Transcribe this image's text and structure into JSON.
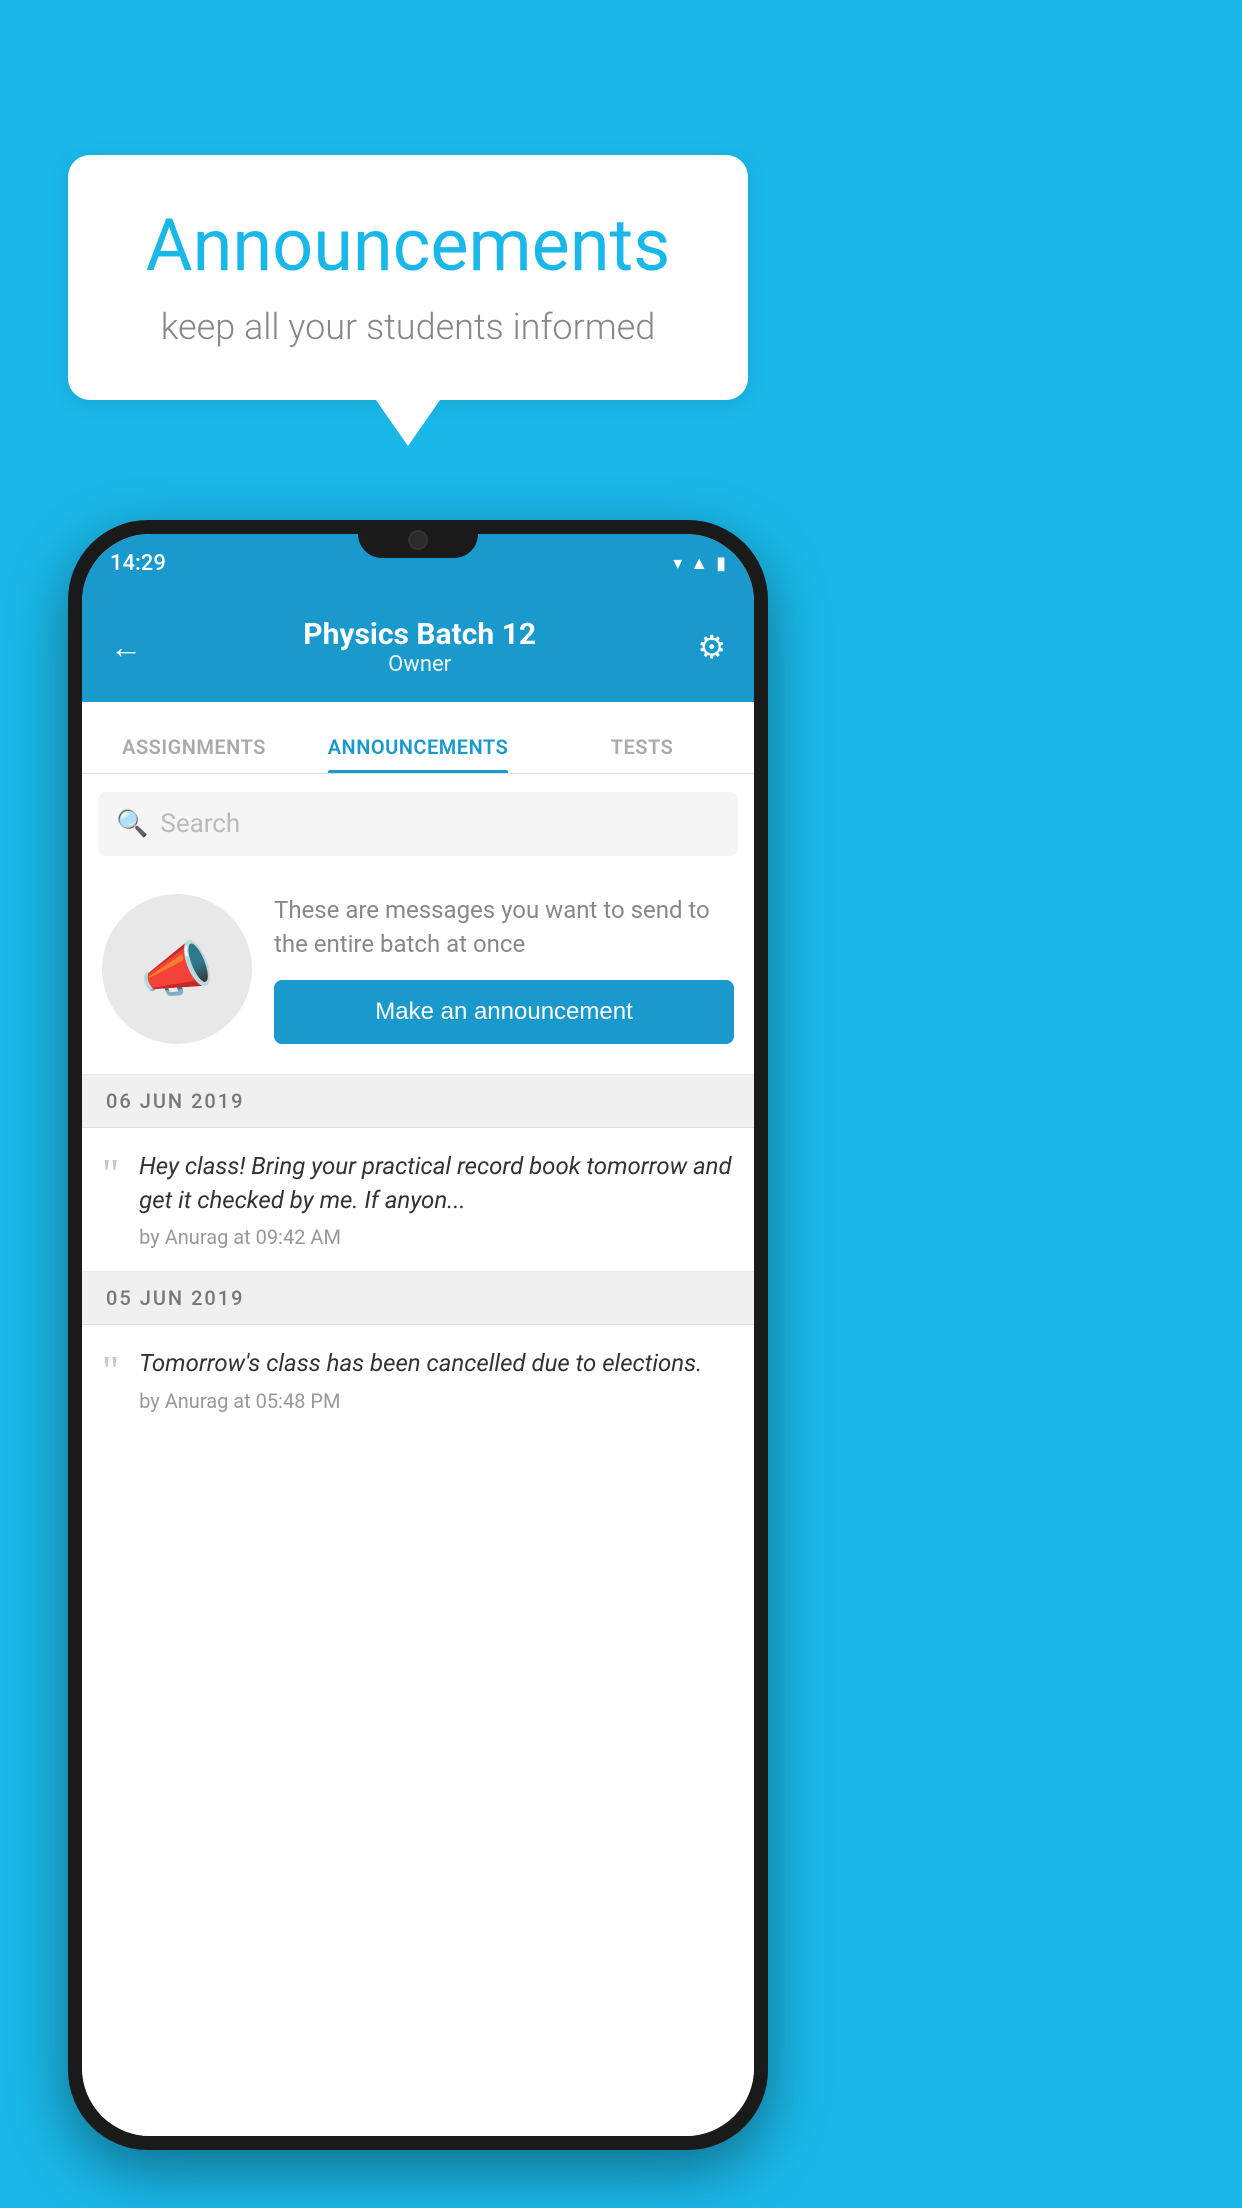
{
  "background_color": "#1ab8e8",
  "speech_bubble": {
    "title": "Announcements",
    "subtitle": "keep all your students informed"
  },
  "status_bar": {
    "time": "14:29",
    "icons": [
      "wifi",
      "signal",
      "battery"
    ]
  },
  "header": {
    "title": "Physics Batch 12",
    "subtitle": "Owner",
    "back_label": "←",
    "gear_label": "⚙"
  },
  "tabs": [
    {
      "label": "ASSIGNMENTS",
      "active": false
    },
    {
      "label": "ANNOUNCEMENTS",
      "active": true
    },
    {
      "label": "TESTS",
      "active": false
    }
  ],
  "search": {
    "placeholder": "Search"
  },
  "promo": {
    "text": "These are messages you want to send to the entire batch at once",
    "button_label": "Make an announcement"
  },
  "announcements": [
    {
      "date": "06  JUN  2019",
      "text": "Hey class! Bring your practical record book tomorrow and get it checked by me. If anyon...",
      "meta": "by Anurag at 09:42 AM"
    },
    {
      "date": "05  JUN  2019",
      "text": "Tomorrow's class has been cancelled due to elections.",
      "meta": "by Anurag at 05:48 PM"
    }
  ]
}
